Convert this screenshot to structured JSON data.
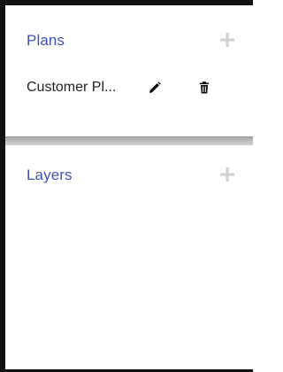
{
  "plans_panel": {
    "title": "Plans",
    "add_icon": "plus-icon",
    "items": [
      {
        "name": "Customer Pl...",
        "edit_icon": "pencil-icon",
        "delete_icon": "trash-icon"
      }
    ]
  },
  "layers_panel": {
    "title": "Layers",
    "add_icon": "plus-icon"
  },
  "colors": {
    "accent": "#3f51b5",
    "add_icon": "#cfcfcf",
    "text": "#222222",
    "frame": "#111111"
  }
}
